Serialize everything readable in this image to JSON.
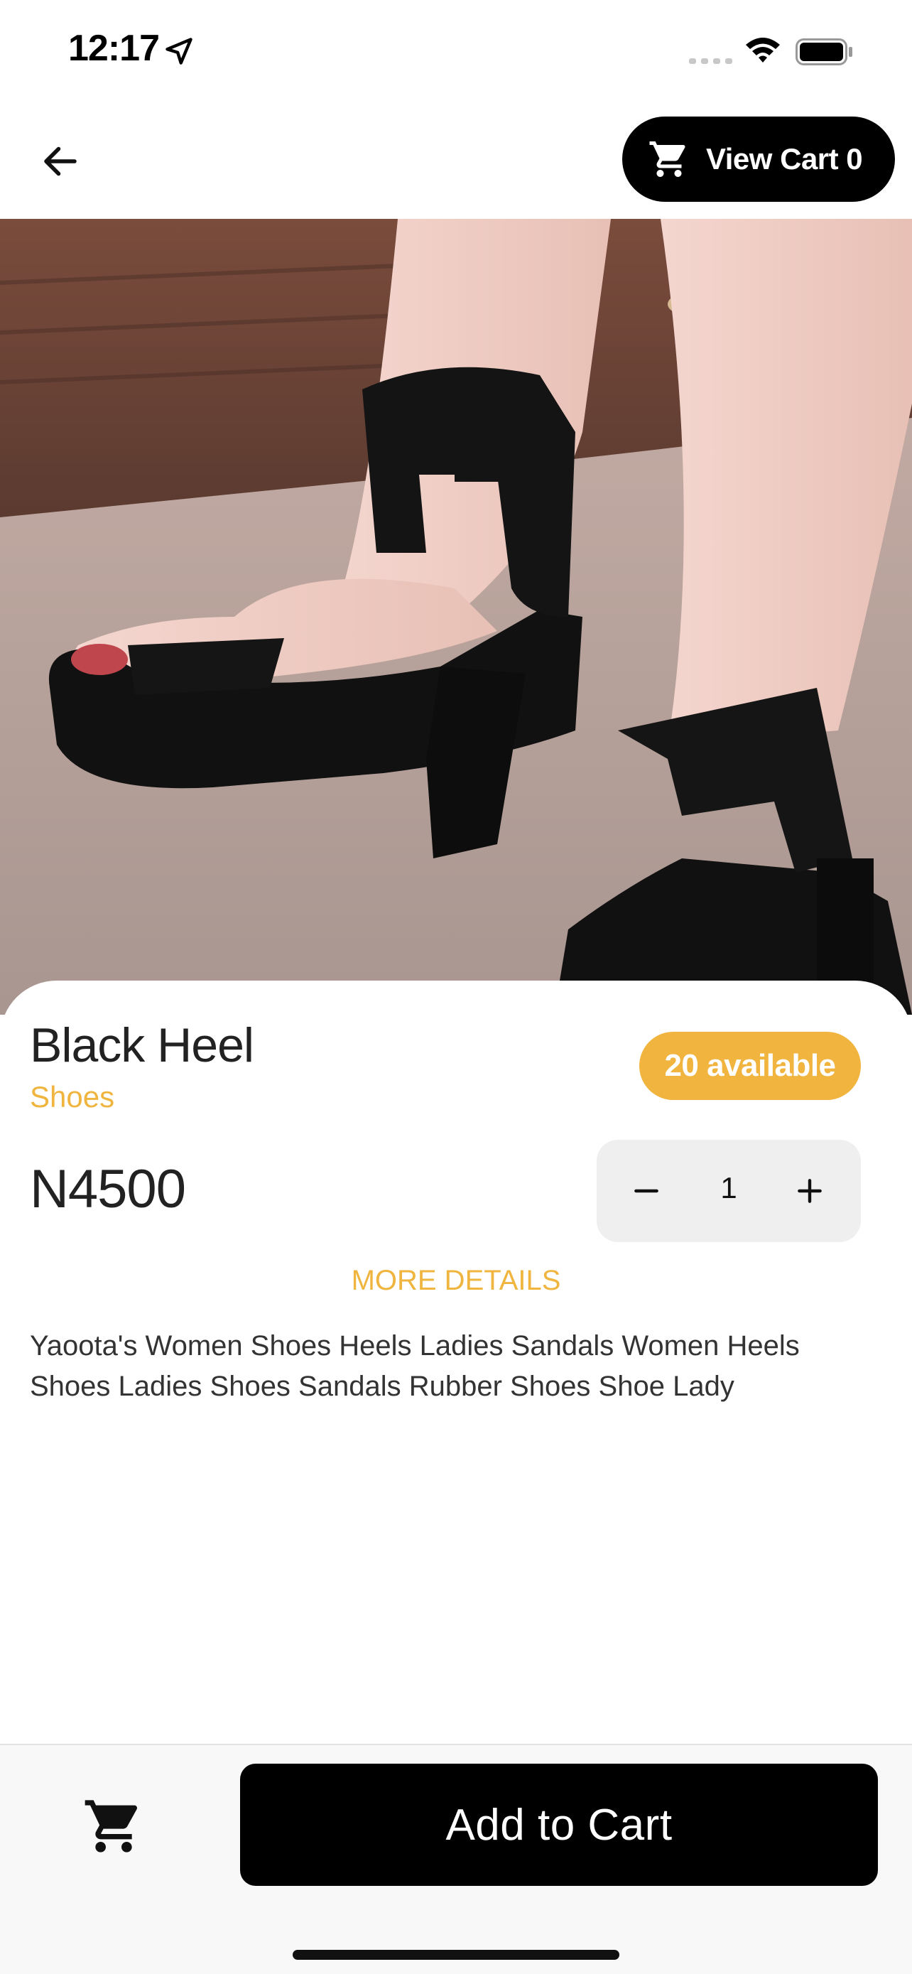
{
  "status_bar": {
    "time": "12:17",
    "icons": [
      "location-arrow-icon",
      "signal-icon",
      "wifi-icon",
      "battery-icon"
    ]
  },
  "header": {
    "back_icon": "arrow-left-icon",
    "view_cart_label": "View Cart 0",
    "view_cart_icon": "cart-icon"
  },
  "product": {
    "image_subject": "product-photo",
    "title": "Black Heel",
    "category": "Shoes",
    "stock_label": "20 available",
    "price": "N4500",
    "quantity": "1",
    "more_details_label": "MORE DETAILS",
    "description": "Yaoota's Women Shoes Heels Ladies Sandals Women Heels Shoes Ladies Shoes Sandals Rubber Shoes Shoe Lady"
  },
  "bottom_bar": {
    "cart_icon": "cart-icon",
    "add_to_cart_label": "Add to Cart"
  },
  "colors": {
    "accent": "#efb53f",
    "badge": "#f0b43f",
    "primary_button": "#000000",
    "stepper_bg": "#efefef"
  }
}
